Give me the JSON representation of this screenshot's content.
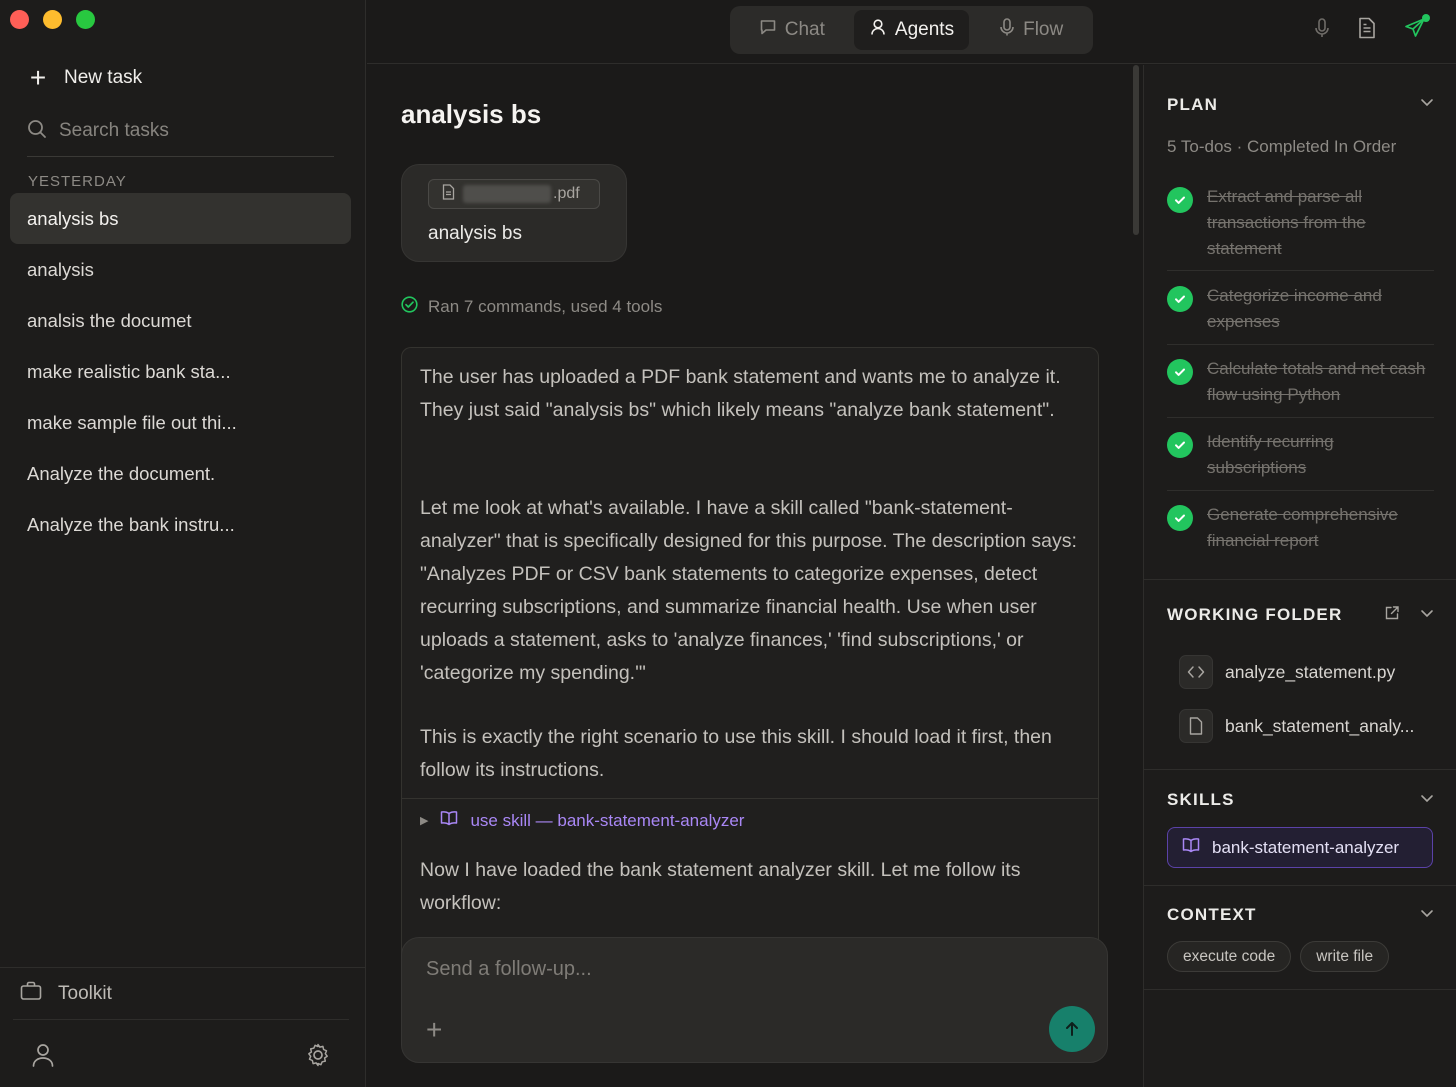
{
  "sidebar": {
    "new_task_label": "New task",
    "search_placeholder": "Search tasks",
    "section_label": "YESTERDAY",
    "tasks": [
      {
        "label": "analysis bs"
      },
      {
        "label": "analysis"
      },
      {
        "label": "analsis the documet"
      },
      {
        "label": "make realistic bank sta..."
      },
      {
        "label": "make sample file out thi..."
      },
      {
        "label": "Analyze the document."
      },
      {
        "label": "Analyze the bank instru..."
      }
    ],
    "toolkit_label": "Toolkit"
  },
  "topbar": {
    "tabs": [
      {
        "label": "Chat"
      },
      {
        "label": "Agents"
      },
      {
        "label": "Flow"
      }
    ]
  },
  "main": {
    "title": "analysis bs",
    "attachment": {
      "file_ext": ".pdf",
      "title": "analysis bs"
    },
    "ran_summary": "Ran 7 commands, used 4 tools",
    "thinking_p1": "The user has uploaded a PDF bank statement and wants me to analyze it. They just said \"analysis bs\" which likely means \"analyze bank statement\".",
    "thinking_p2": "Let me look at what's available. I have a skill called \"bank-statement-analyzer\" that is specifically designed for this purpose. The description says: \"Analyzes PDF or CSV bank statements to categorize expenses, detect recurring subscriptions, and summarize financial health. Use when user uploads a statement, asks to 'analyze finances,' 'find subscriptions,' or 'categorize my spending.'\"",
    "thinking_p3": "This is exactly the right scenario to use this skill. I should load it first, then follow its instructions.",
    "skill_call": "use skill — bank-statement-analyzer",
    "thinking_p4": "Now I have loaded the bank statement analyzer skill. Let me follow its workflow:",
    "composer_placeholder": "Send a follow-up..."
  },
  "right_panel": {
    "plan": {
      "heading": "PLAN",
      "subtitle": "5 To-dos · Completed In Order",
      "todos": [
        {
          "text": "Extract and parse all transactions from the statement"
        },
        {
          "text": "Categorize income and expenses"
        },
        {
          "text": "Calculate totals and net cash flow using Python"
        },
        {
          "text": "Identify recurring subscriptions"
        },
        {
          "text": "Generate comprehensive financial report"
        }
      ]
    },
    "working_folder": {
      "heading": "WORKING FOLDER",
      "files": [
        {
          "name": "analyze_statement.py",
          "icon": "code-icon"
        },
        {
          "name": "bank_statement_analy...",
          "icon": "file-icon"
        }
      ]
    },
    "skills": {
      "heading": "SKILLS",
      "items": [
        {
          "label": "bank-statement-analyzer"
        }
      ]
    },
    "context": {
      "heading": "CONTEXT",
      "chips": [
        {
          "label": "execute code"
        },
        {
          "label": "write file"
        }
      ]
    }
  },
  "colors": {
    "accent_green": "#22c55e",
    "skill_purple": "#a987f5",
    "send_button": "#17806b"
  }
}
